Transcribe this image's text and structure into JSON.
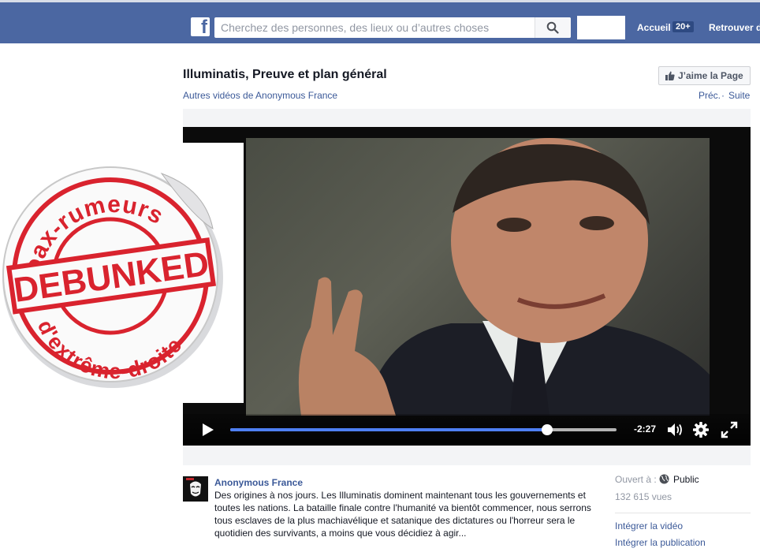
{
  "header": {
    "logo_letter": "f",
    "search_placeholder": "Cherchez des personnes, des lieux ou d’autres choses",
    "nav_home": "Accueil",
    "nav_home_badge": "20+",
    "nav_find": "Retrouver d"
  },
  "page": {
    "title": "Illuminatis, Preuve et plan général",
    "like_button": "J’aime la Page",
    "more_videos": "Autres vidéos de Anonymous France",
    "prev": "Préc.",
    "separator": "·",
    "next": "Suite"
  },
  "player": {
    "time_remaining": "-2:27",
    "progress_fraction": 0.82
  },
  "sticker": {
    "top_text": "Hoax-rumeurs",
    "center_text": "DEBUNKED",
    "bottom_text": "d'extrême-droite"
  },
  "post": {
    "author": "Anonymous France",
    "description": "Des origines à nos jours. Les Illuminatis dominent maintenant tous les gouvernements et toutes les nations. La bataille finale contre l'humanité va bientôt commencer, nous serrons tous esclaves de la plus machiavélique et satanique des dictatures ou l'horreur sera le quotidien des survivants, a moins que vous décidiez à agir..."
  },
  "sidebar": {
    "opened_label": "Ouvert à :",
    "privacy": "Public",
    "views": "132 615 vues",
    "embed_video": "Intégrer la vidéo",
    "embed_post": "Intégrer la publication"
  },
  "colors": {
    "topbar": "#4b67a2",
    "link": "#3b5998",
    "progress": "#4e7ff2",
    "stamp_red": "#d9232e"
  }
}
